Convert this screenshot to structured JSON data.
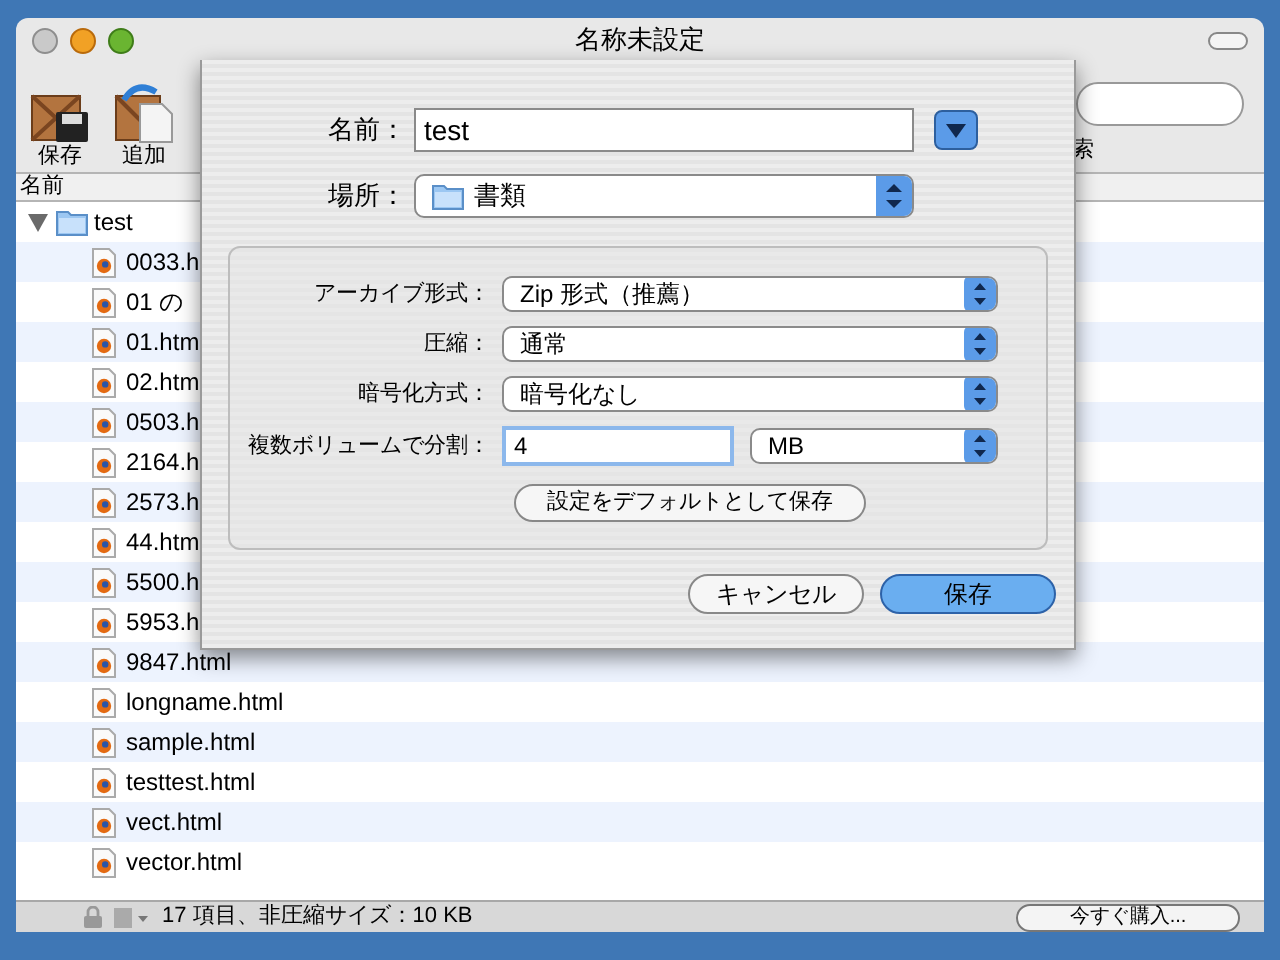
{
  "window": {
    "title": "名称未設定"
  },
  "toolbar": [
    {
      "label": "保存",
      "kind": "save"
    },
    {
      "label": "追加",
      "kind": "add"
    }
  ],
  "toolbar_partial_label": "索",
  "list": {
    "column": "名前",
    "root": {
      "name": "test",
      "expanded": true,
      "children": [
        {
          "name": "0033.h"
        },
        {
          "name": "01 の"
        },
        {
          "name": "01.htm"
        },
        {
          "name": "02.htm"
        },
        {
          "name": "0503.h"
        },
        {
          "name": "2164.h"
        },
        {
          "name": "2573.h"
        },
        {
          "name": "44.htm"
        },
        {
          "name": "5500.h"
        },
        {
          "name": "5953.h"
        },
        {
          "name": "9847.html"
        },
        {
          "name": "longname.html"
        },
        {
          "name": "sample.html"
        },
        {
          "name": "testtest.html"
        },
        {
          "name": "vect.html"
        },
        {
          "name": "vector.html"
        }
      ]
    }
  },
  "sheet": {
    "name_label": "名前：",
    "name_value": "test",
    "location_label": "場所：",
    "location_value": "書類",
    "options": [
      {
        "kind": "popup",
        "label": "アーカイブ形式：",
        "value": "Zip 形式（推薦）"
      },
      {
        "kind": "popup",
        "label": "圧縮：",
        "value": "通常"
      },
      {
        "kind": "popup",
        "label": "暗号化方式：",
        "value": "暗号化なし"
      },
      {
        "kind": "split",
        "label": "複数ボリュームで分割：",
        "value": "4",
        "unit": "MB"
      }
    ],
    "default_button": "設定をデフォルトとして保存",
    "buttons": [
      {
        "label": "キャンセル",
        "default": false
      },
      {
        "label": "保存",
        "default": true
      }
    ]
  },
  "status_bar": {
    "text": "17 項目、非圧縮サイズ：10 KB",
    "button": "今すぐ購入..."
  }
}
